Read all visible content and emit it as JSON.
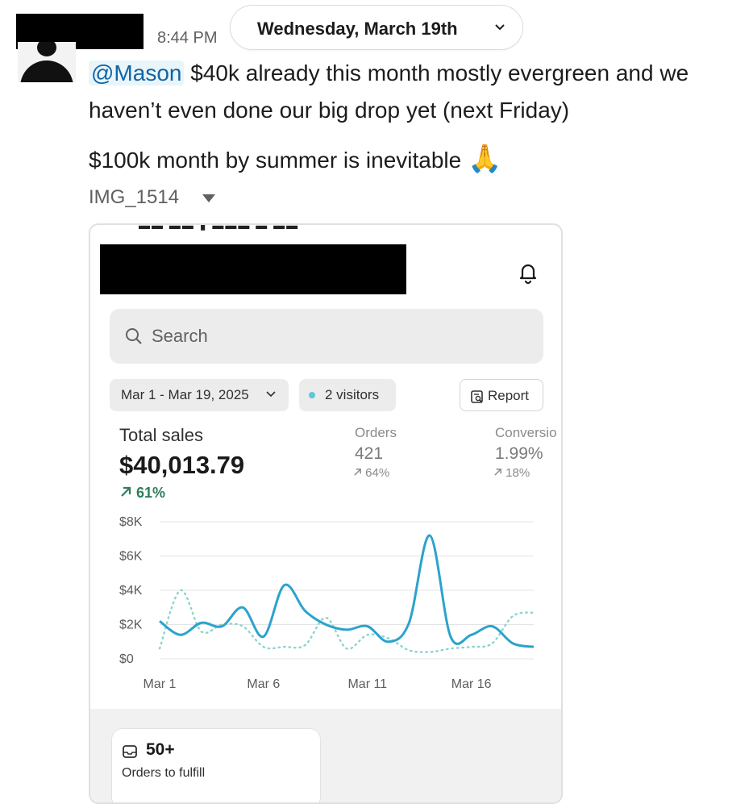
{
  "header": {
    "time": "8:44 PM",
    "date_label": "Wednesday, March 19th"
  },
  "message": {
    "mention": "@Mason",
    "line1_rest": " $40k already this month mostly evergreen and we",
    "line2": "haven’t even done our big drop yet (next Friday)",
    "line3": "$100k month by summer is inevitable",
    "emoji": "🙏"
  },
  "attachment": {
    "file_name": "IMG_1514"
  },
  "screenshot": {
    "search_placeholder": "Search",
    "date_range": "Mar 1 - Mar 19, 2025",
    "visitors": "2 visitors",
    "report_label": "Report",
    "total_sales_label": "Total sales",
    "total_sales_value": "$40,013.79",
    "total_sales_change": "61%",
    "metrics": [
      {
        "label": "Orders",
        "value": "421",
        "change": "64%"
      },
      {
        "label": "Conversio",
        "value": "1.99%",
        "change": "18%"
      }
    ],
    "card": {
      "value": "50+",
      "label": "Orders to fulfill"
    },
    "icons": [
      "search-icon",
      "bell-icon",
      "chevron-down-icon",
      "report-icon",
      "inbox-icon",
      "arrow-up-right-icon"
    ],
    "colors": {
      "current_line": "#2ba3cc",
      "comparison_line": "#8fd3cf",
      "positive_change": "#2e7d5b"
    }
  },
  "chart_data": {
    "type": "line",
    "x": [
      1,
      2,
      3,
      4,
      5,
      6,
      7,
      8,
      9,
      10,
      11,
      12,
      13,
      14,
      15,
      16,
      17,
      18,
      19
    ],
    "x_tick_labels": [
      "Mar 1",
      "Mar 6",
      "Mar 11",
      "Mar 16"
    ],
    "x_tick_values": [
      1,
      6,
      11,
      16
    ],
    "y_tick_labels": [
      "$8K",
      "$6K",
      "$4K",
      "$2K",
      "$0"
    ],
    "ylim": [
      0,
      8000
    ],
    "grid": true,
    "series": [
      {
        "style": "solid",
        "color": "#2ba3cc",
        "values": [
          2200,
          1400,
          2100,
          1900,
          3000,
          1300,
          4300,
          2800,
          2000,
          1700,
          1900,
          1000,
          2100,
          7200,
          1300,
          1400,
          1900,
          900,
          700
        ]
      },
      {
        "style": "dotted",
        "color": "#8fd3cf",
        "values": [
          600,
          4000,
          1600,
          2000,
          1900,
          700,
          700,
          800,
          2400,
          600,
          1400,
          1200,
          500,
          400,
          600,
          700,
          900,
          2500,
          2700
        ]
      }
    ]
  }
}
